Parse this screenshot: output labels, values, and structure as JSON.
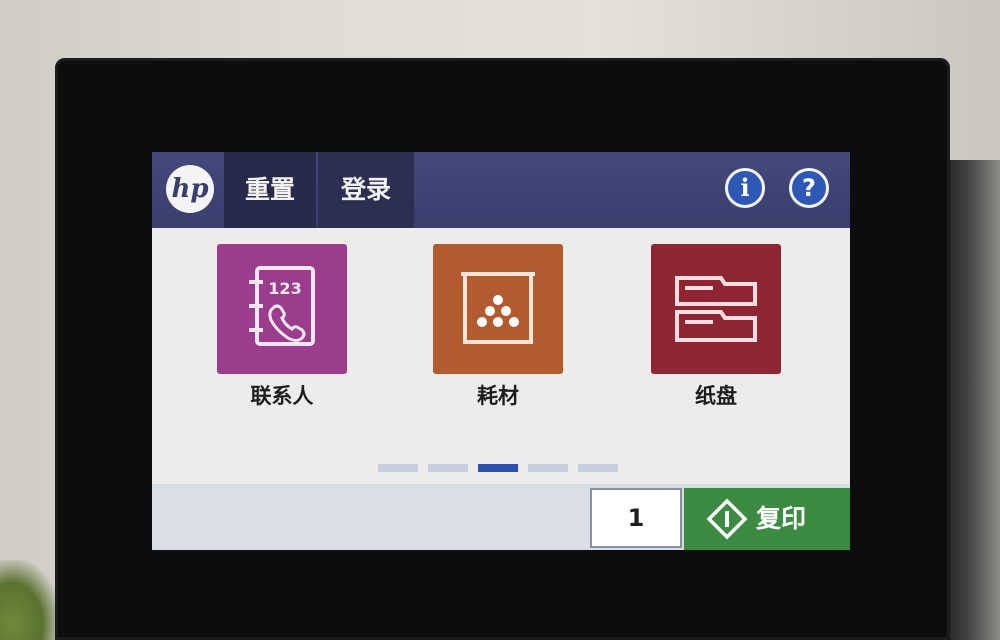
{
  "header": {
    "logo_text": "hp",
    "reset_label": "重置",
    "login_label": "登录",
    "info_glyph": "i",
    "help_glyph": "?"
  },
  "tiles": [
    {
      "label": "联系人",
      "icon": "contacts-book-icon",
      "icon_text": "123",
      "color": "#9b3c8c"
    },
    {
      "label": "耗材",
      "icon": "toner-supplies-icon",
      "color": "#b15b2e"
    },
    {
      "label": "纸盘",
      "icon": "paper-tray-icon",
      "color": "#8f2432"
    }
  ],
  "pagination": {
    "total": 5,
    "active": 3
  },
  "bottom": {
    "copies_value": "1",
    "copy_label": "复印",
    "copy_color": "#3d8a43"
  }
}
